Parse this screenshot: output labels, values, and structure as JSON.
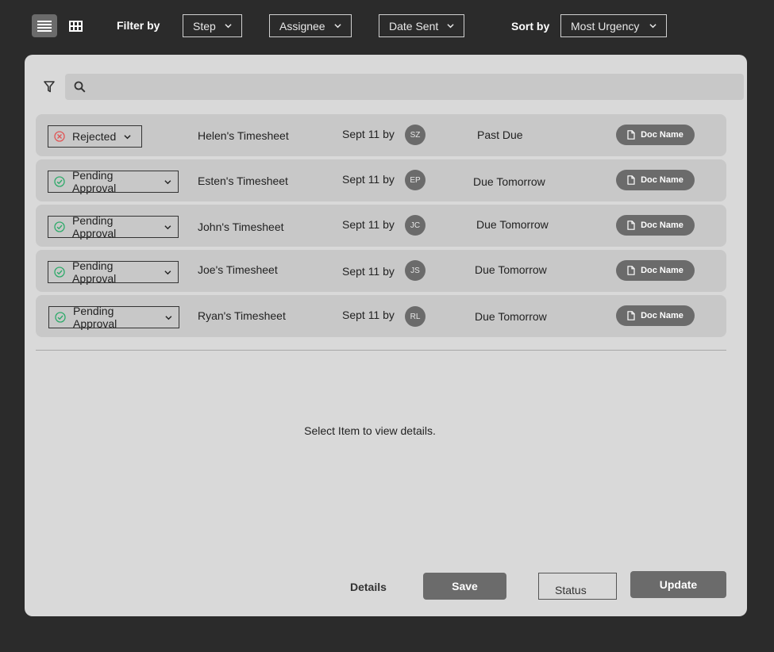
{
  "toolbar": {
    "filter_label": "Filter by",
    "sort_label": "Sort by",
    "filters": [
      {
        "label": "Step"
      },
      {
        "label": "Assignee"
      },
      {
        "label": "Date Sent"
      }
    ],
    "sort_value": "Most Urgency"
  },
  "search": {
    "placeholder": ""
  },
  "rows": [
    {
      "status": "Rejected",
      "status_icon": "x-circle-icon",
      "name": "Helen's Timesheet",
      "date": "Sept 11 by",
      "initials": "SZ",
      "due": "Past Due",
      "doc": "Doc Name"
    },
    {
      "status": "Pending Approval",
      "status_icon": "check-circle-icon",
      "name": "Esten's Timesheet",
      "date": "Sept 11 by",
      "initials": "EP",
      "due": "Due Tomorrow",
      "doc": "Doc Name"
    },
    {
      "status": "Pending Approval",
      "status_icon": "check-circle-icon",
      "name": "John's Timesheet",
      "date": "Sept 11 by",
      "initials": "JC",
      "due": "Due Tomorrow",
      "doc": "Doc Name"
    },
    {
      "status": "Pending Approval",
      "status_icon": "check-circle-icon",
      "name": "Joe's Timesheet",
      "date": "Sept 11 by",
      "initials": "JS",
      "due": "Due Tomorrow",
      "doc": "Doc Name"
    },
    {
      "status": "Pending Approval",
      "status_icon": "check-circle-icon",
      "name": "Ryan's Timesheet",
      "date": "Sept 11 by",
      "initials": "RL",
      "due": "Due Tomorrow",
      "doc": "Doc Name"
    }
  ],
  "detail": {
    "empty_message": "Select Item to view details.",
    "details_label": "Details",
    "save_label": "Save",
    "status_value": "Status",
    "update_label": "Update"
  },
  "colors": {
    "background": "#2b2b2b",
    "panel": "#d9d9d9",
    "row": "#c8c8c8",
    "button": "#6b6b6b",
    "rejected_icon": "#e05555",
    "approved_icon": "#2eaa6a"
  }
}
